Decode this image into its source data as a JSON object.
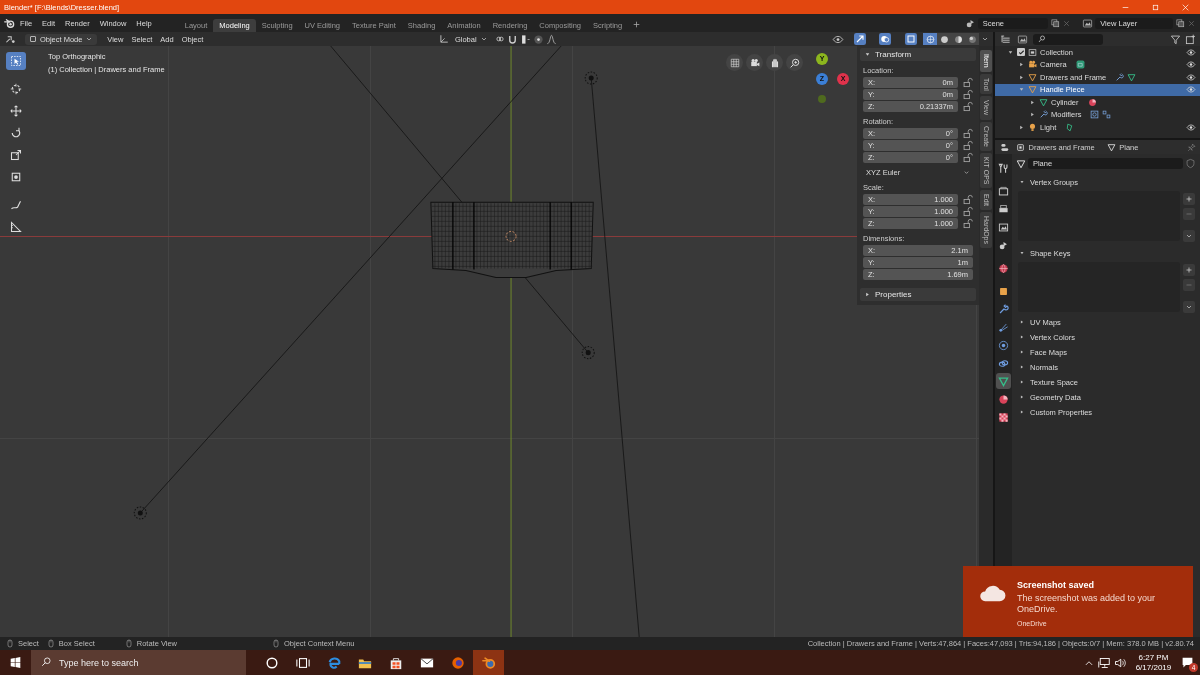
{
  "window": {
    "title": "Blender* [F:\\Blends\\Dresser.blend]"
  },
  "menu": [
    "File",
    "Edit",
    "Render",
    "Window",
    "Help"
  ],
  "workspaces": [
    {
      "label": "Layout",
      "selected": false
    },
    {
      "label": "Modeling",
      "selected": true
    },
    {
      "label": "Sculpting",
      "selected": false
    },
    {
      "label": "UV Editing",
      "selected": false
    },
    {
      "label": "Texture Paint",
      "selected": false
    },
    {
      "label": "Shading",
      "selected": false
    },
    {
      "label": "Animation",
      "selected": false
    },
    {
      "label": "Rendering",
      "selected": false
    },
    {
      "label": "Compositing",
      "selected": false
    },
    {
      "label": "Scripting",
      "selected": false
    }
  ],
  "scene": {
    "scene": "Scene",
    "view_layer": "View Layer"
  },
  "viewport": {
    "mode": "Object Mode",
    "menus": [
      "View",
      "Select",
      "Add",
      "Object"
    ],
    "orientation": "Global",
    "shading": [
      {
        "kind": "wireframe",
        "selected": true
      },
      {
        "kind": "solid",
        "selected": false
      },
      {
        "kind": "material",
        "selected": false
      },
      {
        "kind": "rendered",
        "selected": false
      }
    ],
    "tools": [
      {
        "kind": "select",
        "selected": true
      },
      {
        "kind": "cursor",
        "selected": false
      },
      {
        "kind": "move",
        "selected": false
      },
      {
        "kind": "rotate",
        "selected": false
      },
      {
        "kind": "scale",
        "selected": false
      },
      {
        "kind": "transform",
        "selected": false
      },
      {
        "kind": "annotate",
        "selected": false
      },
      {
        "kind": "measure",
        "selected": false
      }
    ],
    "view_name": "Top Orthographic",
    "view_info": "(1) Collection | Drawers and Frame",
    "axes": [
      {
        "label": "Y",
        "color": "#8cb61e"
      },
      {
        "label": "Z",
        "color": "#3b7fd6"
      },
      {
        "label": "X",
        "color": "#e0324b"
      }
    ]
  },
  "sidebar": {
    "tabs": [
      {
        "label": "Item",
        "selected": true
      },
      {
        "label": "Tool",
        "selected": false
      },
      {
        "label": "View",
        "selected": false
      },
      {
        "label": "Create",
        "selected": false
      },
      {
        "label": "KIT OPS",
        "selected": false
      },
      {
        "label": "Edit",
        "selected": false
      },
      {
        "label": "HardOps",
        "selected": false
      }
    ],
    "panels": [
      {
        "label": "Transform",
        "expanded": true,
        "sections": [
          {
            "kind": "fields",
            "label": "Location:",
            "lockable": true,
            "rows": [
              {
                "axis": "X:",
                "value": "0m"
              },
              {
                "axis": "Y:",
                "value": "0m"
              },
              {
                "axis": "Z:",
                "value": "0.21337m"
              }
            ]
          },
          {
            "kind": "fields",
            "label": "Rotation:",
            "lockable": true,
            "rows": [
              {
                "axis": "X:",
                "value": "0°"
              },
              {
                "axis": "Y:",
                "value": "0°"
              },
              {
                "axis": "Z:",
                "value": "0°"
              }
            ]
          },
          {
            "kind": "dropdown",
            "value": "XYZ Euler"
          },
          {
            "kind": "fields",
            "label": "Scale:",
            "lockable": true,
            "rows": [
              {
                "axis": "X:",
                "value": "1.000"
              },
              {
                "axis": "Y:",
                "value": "1.000"
              },
              {
                "axis": "Z:",
                "value": "1.000"
              }
            ]
          },
          {
            "kind": "fields",
            "label": "Dimensions:",
            "lockable": false,
            "rows": [
              {
                "axis": "X:",
                "value": "2.1m"
              },
              {
                "axis": "Y:",
                "value": "1m"
              },
              {
                "axis": "Z:",
                "value": "1.69m"
              }
            ]
          }
        ]
      },
      {
        "label": "Properties",
        "expanded": false
      }
    ]
  },
  "outliner": {
    "tree": [
      {
        "label": "Collection",
        "kind": "collection",
        "checked": true,
        "expanded": true,
        "selected": false,
        "visible": true,
        "children": [
          {
            "label": "Camera",
            "kind": "camera",
            "expanded": false,
            "selected": false,
            "visible": true,
            "extras": [
              {
                "kind": "camera-data"
              }
            ]
          },
          {
            "label": "Drawers and Frame",
            "kind": "mesh-object",
            "expanded": false,
            "selected": false,
            "visible": true,
            "extras": [
              {
                "kind": "modifier"
              },
              {
                "kind": "mesh-data"
              }
            ]
          },
          {
            "label": "Handle Piece",
            "kind": "mesh-object",
            "expanded": true,
            "selected": true,
            "visible": true,
            "children": [
              {
                "label": "Cylinder",
                "kind": "mesh-data",
                "expanded": false,
                "selected": false,
                "extras": [
                  {
                    "kind": "material"
                  }
                ]
              },
              {
                "label": "Modifiers",
                "kind": "modifier",
                "expanded": false,
                "selected": false,
                "extras": [
                  {
                    "kind": "modifier-a"
                  },
                  {
                    "kind": "modifier-b"
                  }
                ]
              }
            ]
          },
          {
            "label": "Light",
            "kind": "light",
            "expanded": false,
            "selected": false,
            "visible": true,
            "extras": [
              {
                "kind": "light-data"
              }
            ]
          }
        ]
      }
    ]
  },
  "properties": {
    "object": "Drawers and Frame",
    "data": "Plane",
    "datablock": "Plane",
    "tabs": [
      {
        "kind": "tool",
        "selected": false
      },
      {
        "kind": "render",
        "selected": false
      },
      {
        "kind": "output",
        "selected": false
      },
      {
        "kind": "view-layer",
        "selected": false
      },
      {
        "kind": "scene",
        "selected": false
      },
      {
        "kind": "world",
        "selected": false
      },
      {
        "kind": "object",
        "selected": false
      },
      {
        "kind": "modifiers",
        "selected": false
      },
      {
        "kind": "particles",
        "selected": false
      },
      {
        "kind": "physics",
        "selected": false
      },
      {
        "kind": "constraints",
        "selected": false
      },
      {
        "kind": "data",
        "selected": true
      },
      {
        "kind": "material",
        "selected": false
      },
      {
        "kind": "texture",
        "selected": false
      }
    ],
    "panels": [
      {
        "label": "Vertex Groups",
        "expanded": true
      },
      {
        "label": "Shape Keys",
        "expanded": true
      },
      {
        "label": "UV Maps",
        "expanded": false
      },
      {
        "label": "Vertex Colors",
        "expanded": false
      },
      {
        "label": "Face Maps",
        "expanded": false
      },
      {
        "label": "Normals",
        "expanded": false
      },
      {
        "label": "Texture Space",
        "expanded": false
      },
      {
        "label": "Geometry Data",
        "expanded": false
      },
      {
        "label": "Custom Properties",
        "expanded": false
      }
    ]
  },
  "status_bar": {
    "hints": [
      "Select",
      "Box Select",
      "Rotate View",
      "Object Context Menu"
    ],
    "stats": "Collection | Drawers and Frame | Verts:47,864 | Faces:47,093 | Tris:94,186 | Objects:0/7 | Mem: 378.0 MB | v2.80.74"
  },
  "taskbar": {
    "search": {
      "placeholder": "Type here to search"
    },
    "apps": [
      {
        "kind": "cortana",
        "active": false
      },
      {
        "kind": "task-view",
        "active": false
      },
      {
        "kind": "edge",
        "active": false
      },
      {
        "kind": "explorer",
        "active": false
      },
      {
        "kind": "store",
        "active": false
      },
      {
        "kind": "mail",
        "active": false
      },
      {
        "kind": "firefox",
        "active": false
      },
      {
        "kind": "blender",
        "active": true
      }
    ],
    "time": "6:27 PM",
    "date": "6/17/2019",
    "notifications": "4"
  },
  "toast": {
    "title": "Screenshot saved",
    "body": "The screenshot was added to your OneDrive.",
    "source": "OneDrive"
  }
}
